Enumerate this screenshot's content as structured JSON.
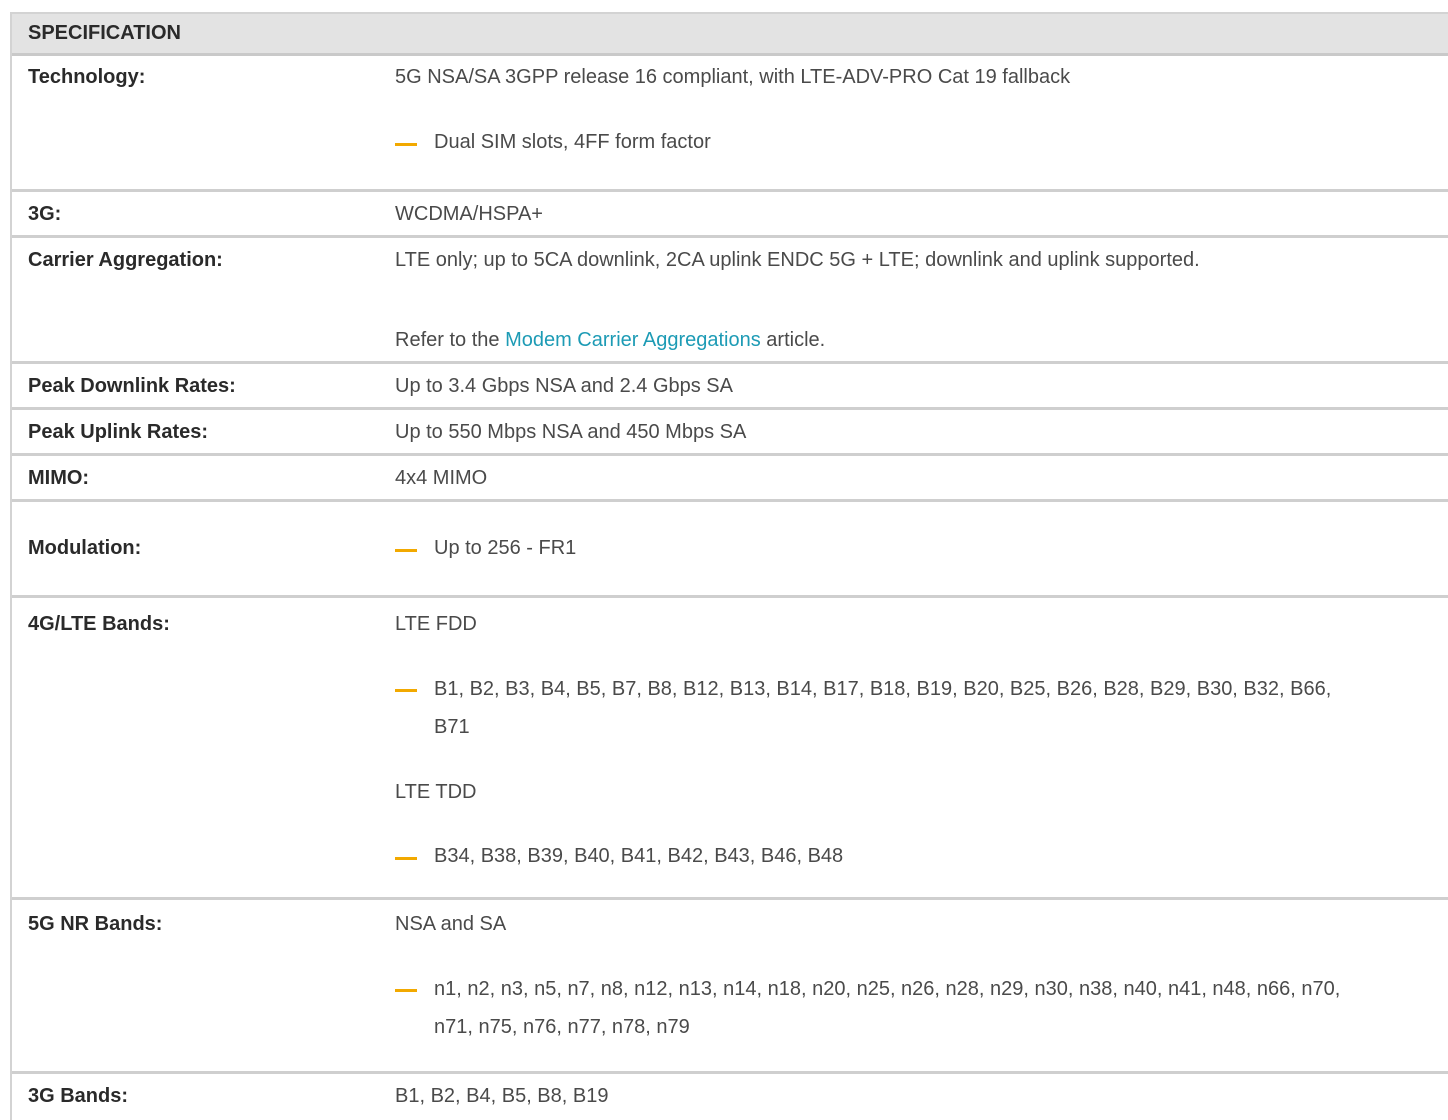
{
  "table": {
    "header": "SPECIFICATION",
    "rows": {
      "technology": {
        "label": "Technology:",
        "line1": "5G NSA/SA 3GPP release 16 compliant, with LTE-ADV-PRO Cat 19 fallback",
        "bullet": "Dual SIM slots, 4FF form factor"
      },
      "g3": {
        "label": "3G:",
        "value": "WCDMA/HSPA+"
      },
      "carrier": {
        "label": "Carrier Aggregation:",
        "line1": "LTE only; up to 5CA downlink, 2CA uplink ENDC 5G + LTE; downlink and uplink supported.",
        "refer_prefix": "Refer to the ",
        "refer_link": "Modem Carrier Aggregations",
        "refer_suffix": " article."
      },
      "peak_down": {
        "label": "Peak Downlink Rates:",
        "value": "Up to 3.4 Gbps NSA and 2.4 Gbps SA"
      },
      "peak_up": {
        "label": "Peak Uplink Rates:",
        "value": "Up to 550 Mbps NSA and 450 Mbps SA"
      },
      "mimo": {
        "label": "MIMO:",
        "value": "4x4 MIMO"
      },
      "modulation": {
        "label": "Modulation:",
        "bullet": "Up to 256 - FR1"
      },
      "lte": {
        "label": "4G/LTE Bands:",
        "fdd_title": "LTE FDD",
        "fdd_line1": "B1, B2, B3, B4, B5, B7, B8, B12, B13, B14, B17, B18, B19, B20, B25, B26, B28, B29, B30, B32, B66,",
        "fdd_line2": "B71",
        "tdd_title": "LTE TDD",
        "tdd_bands": "B34, B38, B39, B40, B41, B42, B43, B46, B48"
      },
      "nr": {
        "label": "5G NR Bands:",
        "title": "NSA and SA",
        "line1": "n1, n2, n3, n5, n7, n8, n12, n13, n14, n18, n20, n25, n26, n28, n29, n30, n38, n40, n41, n48, n66, n70,",
        "line2": "n71, n75, n76, n77, n78, n79"
      },
      "g3_bands": {
        "label": "3G Bands:",
        "value": "B1, B2, B4, B5, B8, B19"
      }
    }
  },
  "colors": {
    "bullet_dash": "#f2a900",
    "link": "#1d9bb5",
    "header_bg": "#e3e3e3"
  }
}
